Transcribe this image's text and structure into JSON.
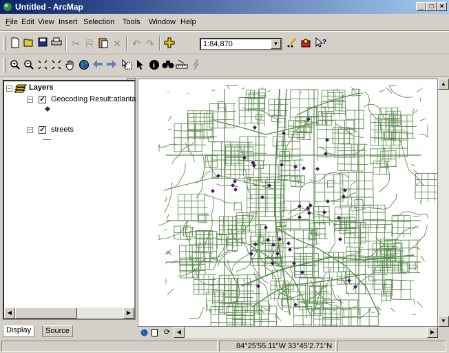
{
  "window": {
    "title": "Untitled - ArcMap"
  },
  "menu": [
    {
      "label": "File",
      "accel": "F"
    },
    {
      "label": "Edit",
      "accel": "E"
    },
    {
      "label": "View",
      "accel": "V"
    },
    {
      "label": "Insert",
      "accel": "I"
    },
    {
      "label": "Selection",
      "accel": "S"
    },
    {
      "label": "Tools",
      "accel": "T"
    },
    {
      "label": "Window",
      "accel": "W"
    },
    {
      "label": "Help",
      "accel": "H"
    }
  ],
  "standard_toolbar": {
    "scale": "1:84,870"
  },
  "toc": {
    "root": "Layers",
    "layers": [
      {
        "name": "Geocoding Result:atlanta",
        "checked": true,
        "symbol_color": "#4b1466"
      },
      {
        "name": "streets",
        "checked": true,
        "symbol_color": "#5b8a4e"
      }
    ]
  },
  "tabs": {
    "display": "Display",
    "source": "Source"
  },
  "status": {
    "coordinates": "84°25'55.11\"W  33°45'2.71\"N"
  },
  "map": {
    "street_color": "#5b8a4e",
    "point_color": "#4b1466"
  }
}
